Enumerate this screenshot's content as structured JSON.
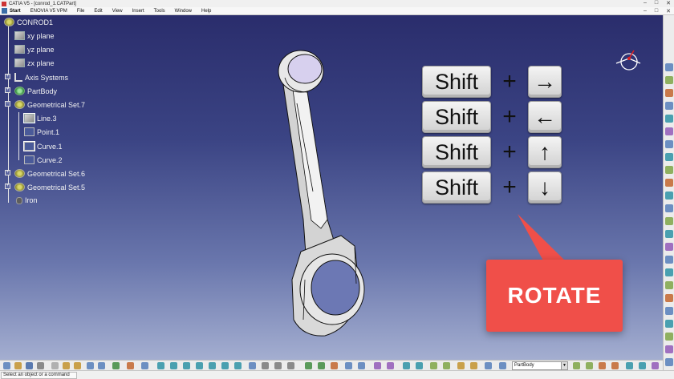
{
  "window": {
    "title": "CATIA V5 - [conrod_1.CATPart]",
    "controls": [
      "–",
      "□",
      "✕"
    ]
  },
  "menu": {
    "items": [
      "Start",
      "ENOVIA V5 VPM",
      "File",
      "Edit",
      "View",
      "Insert",
      "Tools",
      "Window",
      "Help"
    ],
    "doc_controls": [
      "–",
      "□",
      "✕"
    ]
  },
  "tree": {
    "nodes": [
      {
        "label": "CONROD1",
        "icon": "gear-icon"
      },
      {
        "label": "xy plane",
        "icon": "plane-icon"
      },
      {
        "label": "yz plane",
        "icon": "plane-icon"
      },
      {
        "label": "zx plane",
        "icon": "plane-icon"
      },
      {
        "label": "Axis Systems",
        "icon": "axis-system-icon"
      },
      {
        "label": "PartBody",
        "icon": "part-body-icon"
      },
      {
        "label": "Geometrical Set.7",
        "icon": "geometrical-set-icon"
      },
      {
        "label": "Line.3",
        "icon": "line-icon"
      },
      {
        "label": "Point.1",
        "icon": "point-icon"
      },
      {
        "label": "Curve.1",
        "icon": "curve-icon"
      },
      {
        "label": "Curve.2",
        "icon": "curve-icon"
      },
      {
        "label": "Geometrical Set.6",
        "icon": "geometrical-set-icon"
      },
      {
        "label": "Geometrical Set.5",
        "icon": "geometrical-set-icon"
      },
      {
        "label": "Iron",
        "icon": "material-icon"
      }
    ]
  },
  "shortcuts": {
    "rows": [
      {
        "key": "Shift",
        "plus": "+",
        "arrow": "→"
      },
      {
        "key": "Shift",
        "plus": "+",
        "arrow": "←"
      },
      {
        "key": "Shift",
        "plus": "+",
        "arrow": "↑"
      },
      {
        "key": "Shift",
        "plus": "+",
        "arrow": "↓"
      }
    ]
  },
  "callout": {
    "text": "ROTATE",
    "color": "#f04f49"
  },
  "toolbar": {
    "combo_value": "PartBody"
  },
  "status": {
    "text": "Select an object or a command"
  },
  "colors": {
    "viewport_top": "#2a2d6c",
    "viewport_bottom": "#aab4d4",
    "part_fill": "#e4e4e4"
  }
}
